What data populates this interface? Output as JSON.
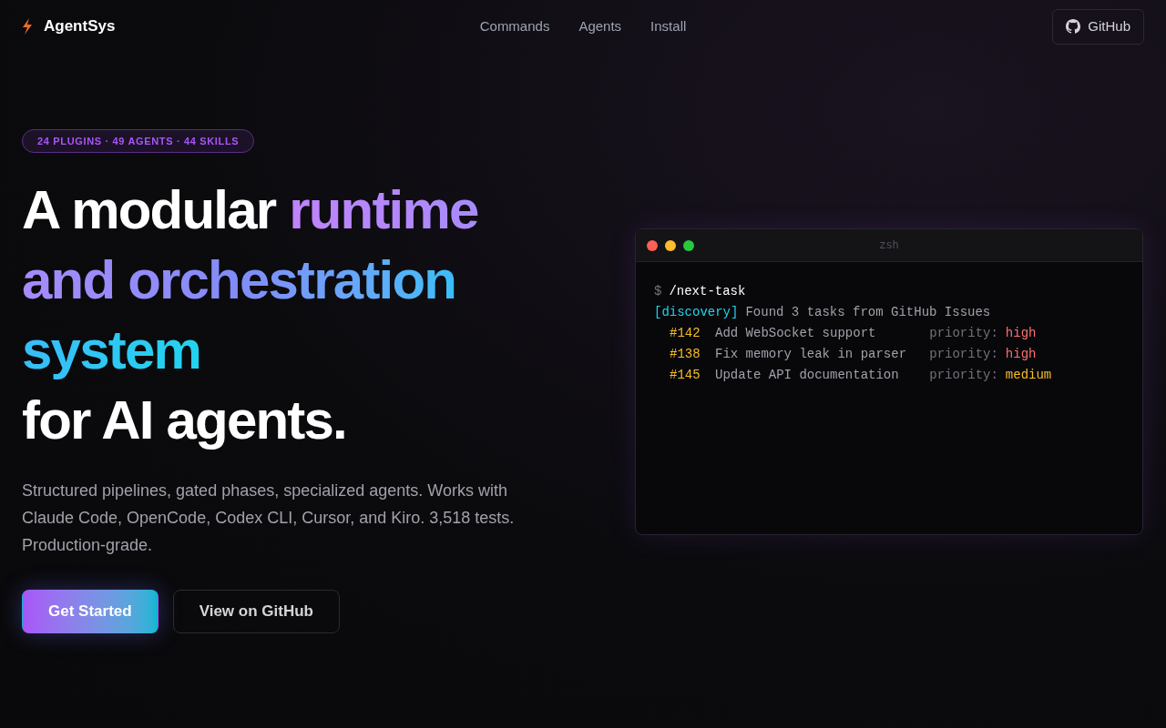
{
  "brand": {
    "name": "AgentSys"
  },
  "nav": [
    {
      "label": "Commands"
    },
    {
      "label": "Agents"
    },
    {
      "label": "Install"
    }
  ],
  "github_button": {
    "label": "GitHub"
  },
  "badge": "24 PLUGINS · 49 AGENTS · 44 SKILLS",
  "headline": [
    [
      {
        "text": "A modular ",
        "kind": "plain"
      },
      {
        "text": "runtime",
        "kind": "purple"
      }
    ],
    [
      {
        "text": "and orchestration",
        "kind": "gradient"
      }
    ],
    [
      {
        "text": "system",
        "kind": "cyan"
      }
    ],
    [
      {
        "text": "for AI agents.",
        "kind": "plain"
      }
    ]
  ],
  "description": "Structured pipelines, gated phases, specialized agents. Works with Claude Code, OpenCode, Codex CLI, Cursor, and Kiro. 3,518 tests. Production-grade.",
  "buttons": [
    {
      "label": "Get Started",
      "kind": "primary"
    },
    {
      "label": "View on GitHub",
      "kind": "secondary"
    }
  ],
  "terminal": {
    "title": "zsh",
    "prompt": "$",
    "command": "/next-task",
    "tag": "[discovery]",
    "message": "Found 3 tasks from GitHub Issues",
    "tasks": [
      {
        "id": "#142",
        "title": "Add WebSocket support",
        "label": "priority:",
        "priority": "high"
      },
      {
        "id": "#138",
        "title": "Fix memory leak in parser",
        "label": "priority:",
        "priority": "high"
      },
      {
        "id": "#145",
        "title": "Update API documentation",
        "label": "priority:",
        "priority": "medium"
      }
    ]
  }
}
